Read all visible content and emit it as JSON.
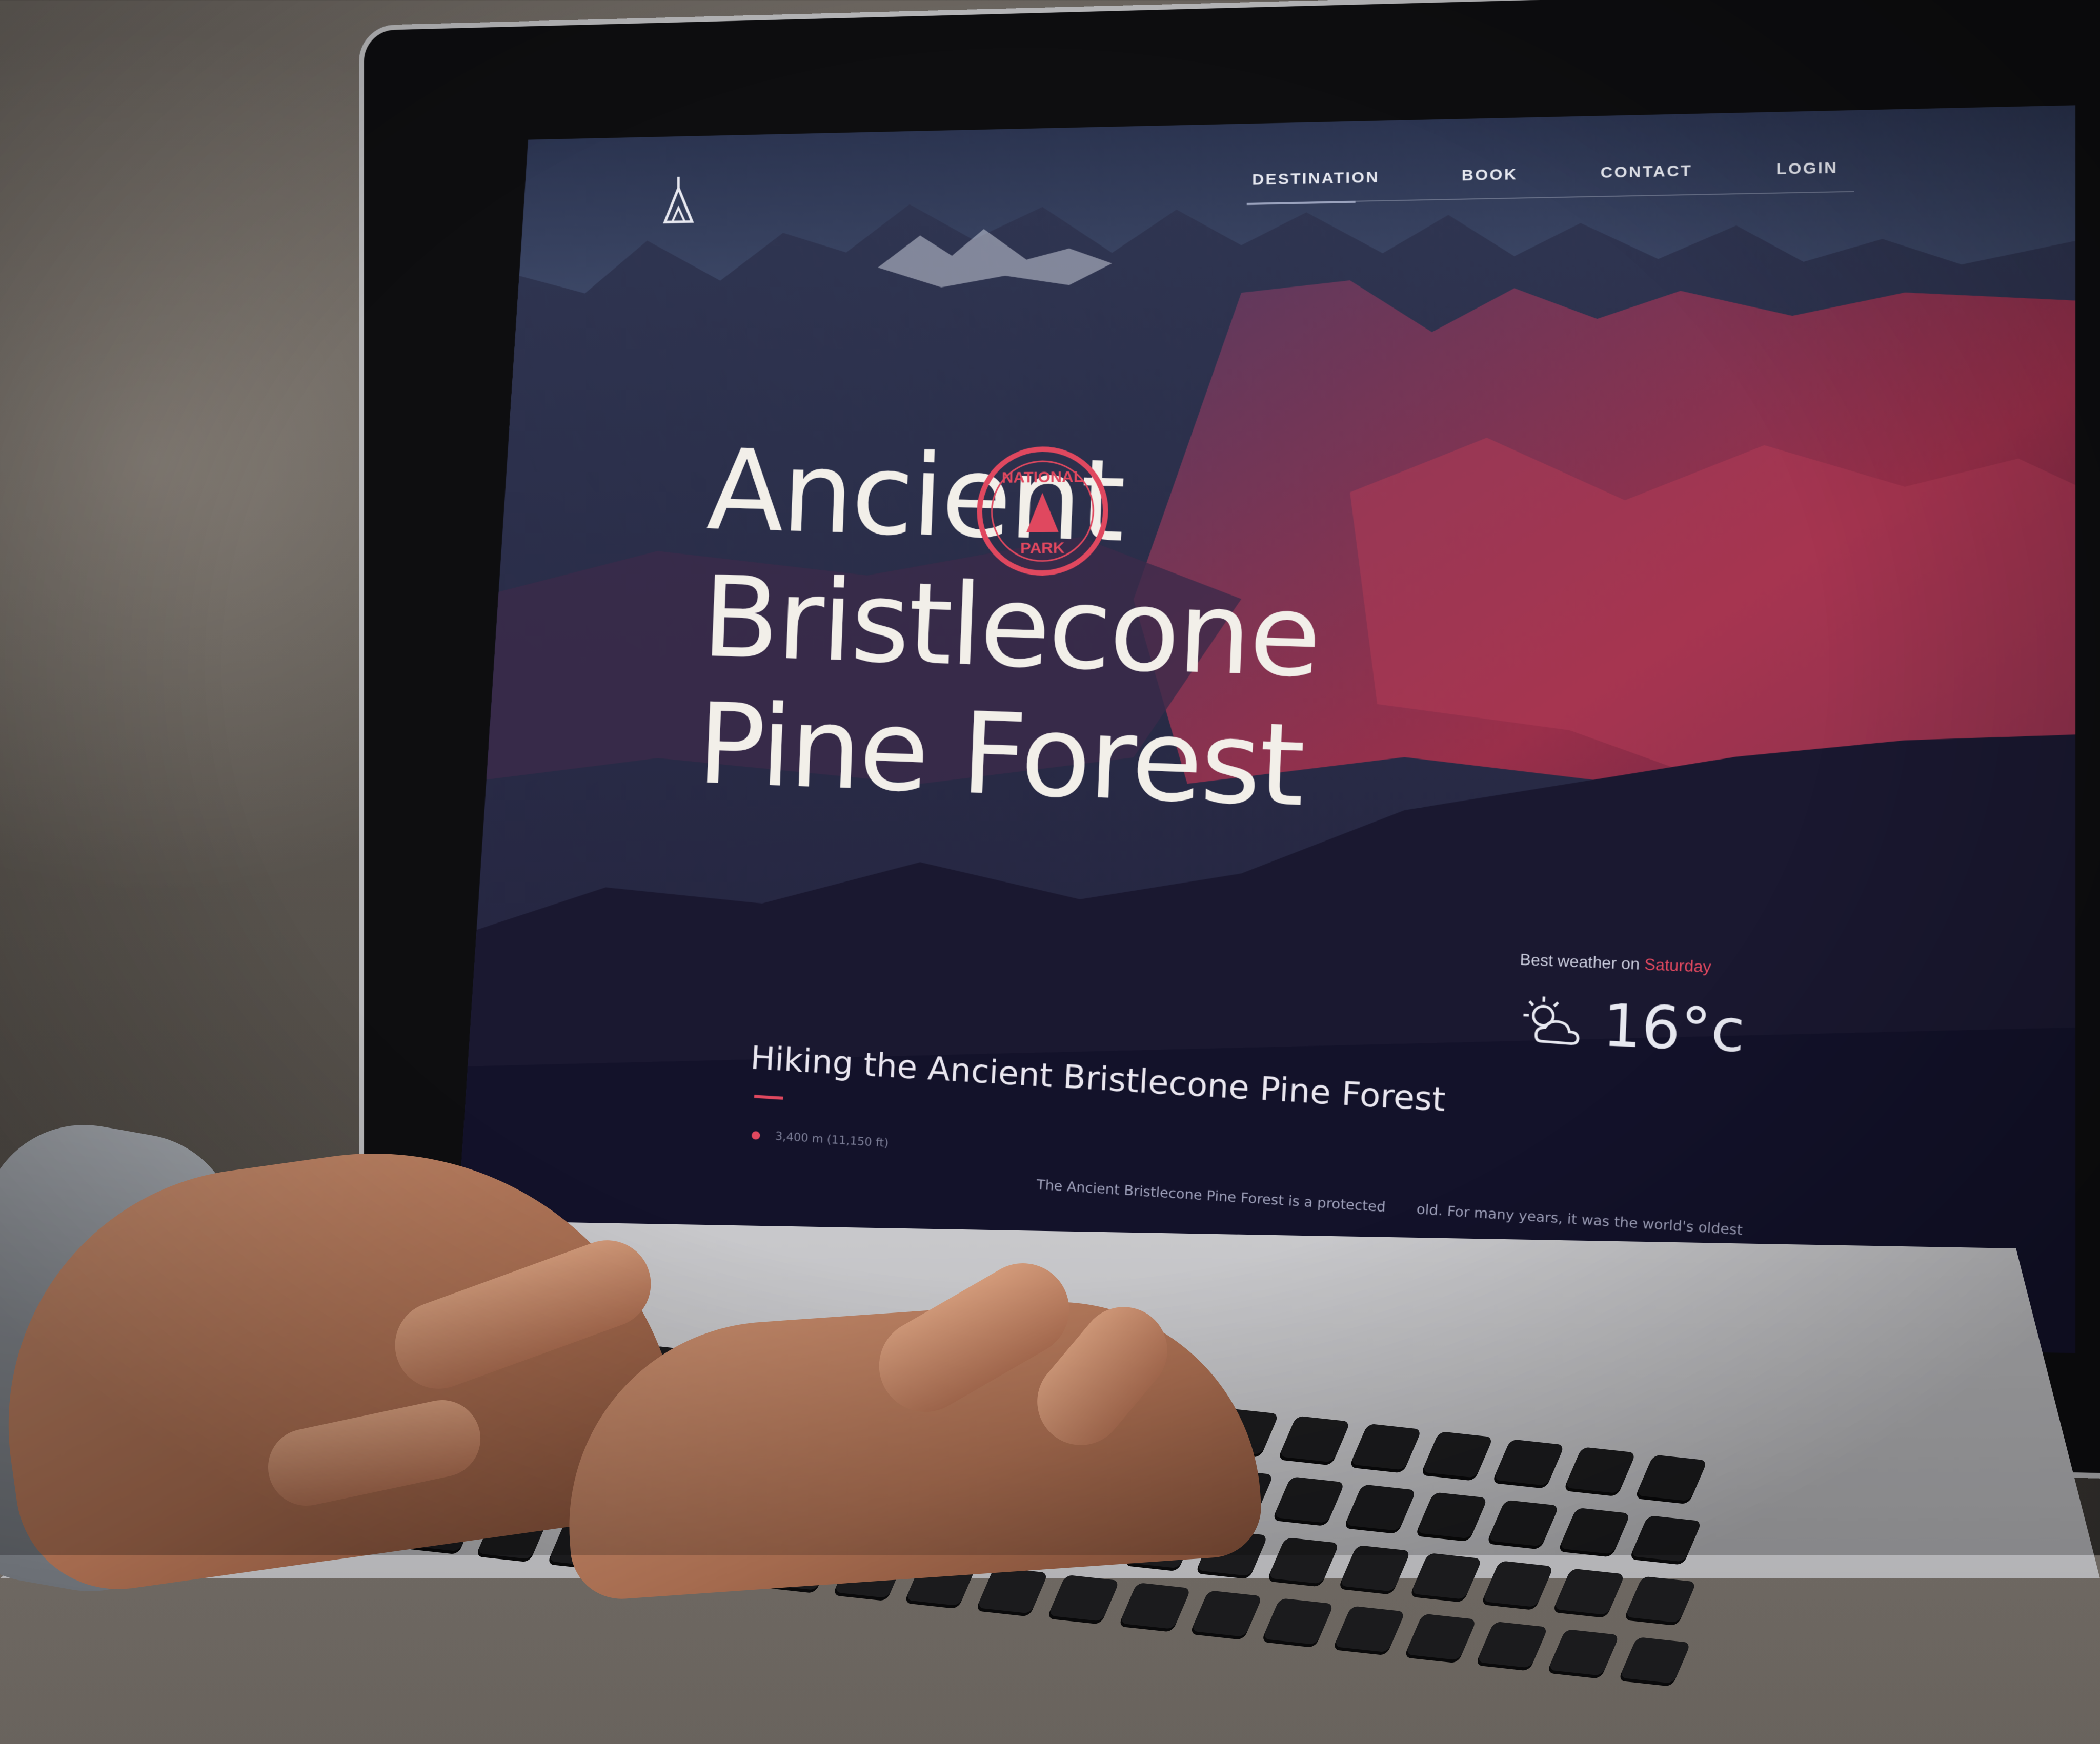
{
  "site": {
    "nav": [
      "DESTINATION",
      "BOOK",
      "CONTACT",
      "LOGIN"
    ],
    "hero_title_lines": [
      "Ancient",
      "Bristlecone",
      "Pine Forest"
    ],
    "badge_top": "NATIONAL",
    "badge_bottom": "PARK",
    "weather_prefix": "Best weather on",
    "weather_day": "Saturday",
    "weather_temp": "16°c",
    "section_title": "Hiking the Ancient Bristlecone Pine Forest",
    "meta": "3,400 m (11,150 ft)",
    "body_text_1": "The Ancient Bristlecone Pine Forest is a protected",
    "body_text_2": "old. For many years, it was the world's oldest"
  },
  "colors": {
    "accent": "#e0485f",
    "sky": "#3c4766",
    "text": "#f2efe9"
  },
  "icons": [
    "logo-icon",
    "weather-cloud-sun-icon",
    "location-pin-icon",
    "badge-emblem-icon"
  ]
}
